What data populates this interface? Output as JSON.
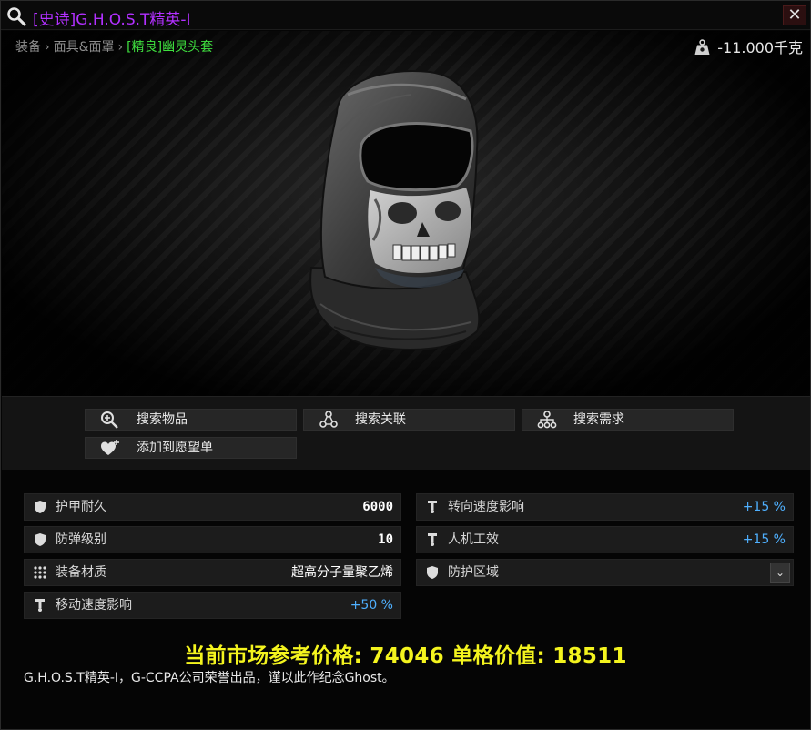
{
  "title": {
    "rarity_tag": "[史诗]",
    "name": "G.H.O.S.T精英-I"
  },
  "breadcrumb": {
    "items": [
      "装备",
      "面具&面罩"
    ],
    "separator": "›",
    "current": "[精良]幽灵头套"
  },
  "weight": {
    "value": "-11.000千克",
    "icon": "weight-icon"
  },
  "actions": {
    "search_item": "搜索物品",
    "search_related": "搜索关联",
    "search_required": "搜索需求",
    "add_wishlist": "添加到愿望单"
  },
  "stats": {
    "armor_durability": {
      "label": "护甲耐久",
      "value": "6000"
    },
    "armor_class": {
      "label": "防弹级别",
      "value": "10"
    },
    "material": {
      "label": "装备材质",
      "value": "超高分子量聚乙烯"
    },
    "move_speed": {
      "label": "移动速度影响",
      "value": "+50 %"
    },
    "turn_speed": {
      "label": "转向速度影响",
      "value": "+15 %"
    },
    "ergonomics": {
      "label": "人机工效",
      "value": "+15 %"
    },
    "protect_zone": {
      "label": "防护区域",
      "value": ""
    }
  },
  "price_line": "当前市场参考价格: 74046 单格价值: 18511",
  "description": "G.H.O.S.T精英-I，G-CCPA公司荣誉出品，谨以此作纪念Ghost。",
  "colors": {
    "rarity": "#b230ff",
    "current_crumb": "#3fe03f",
    "price": "#f4f41e",
    "positive": "#4fb0ff"
  }
}
